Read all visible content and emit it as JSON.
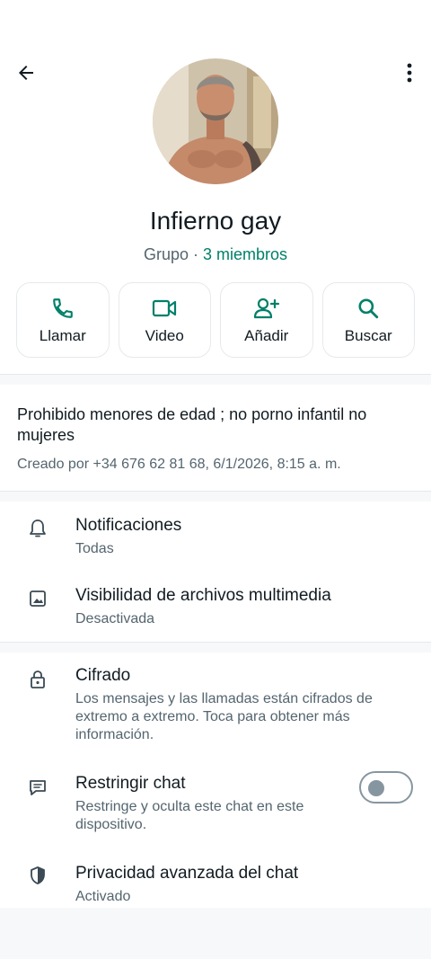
{
  "header": {
    "back_icon": "arrow-left-icon",
    "menu_icon": "more-vertical-icon"
  },
  "group": {
    "name": "Infierno gay",
    "type_label": "Grupo",
    "separator": " · ",
    "members_label": "3 miembros"
  },
  "actions": [
    {
      "label": "Llamar",
      "icon": "phone-icon"
    },
    {
      "label": "Video",
      "icon": "video-icon"
    },
    {
      "label": "Añadir",
      "icon": "add-person-icon"
    },
    {
      "label": "Buscar",
      "icon": "search-icon"
    }
  ],
  "description": {
    "text": "Prohibido menores de edad ; no porno infantil no mujeres",
    "created": "Creado por +34 676 62 81 68, 6/1/2026, 8:15 a. m."
  },
  "settings": {
    "notifications": {
      "title": "Notificaciones",
      "subtitle": "Todas"
    },
    "media": {
      "title": "Visibilidad de archivos multimedia",
      "subtitle": "Desactivada"
    },
    "encryption": {
      "title": "Cifrado",
      "subtitle": "Los mensajes y las llamadas están cifrados de extremo a extremo. Toca para obtener más información."
    },
    "restrict": {
      "title": "Restringir chat",
      "subtitle": "Restringe y oculta este chat en este dispositivo.",
      "enabled": false
    },
    "privacy": {
      "title": "Privacidad avanzada del chat",
      "subtitle": "Activado"
    }
  },
  "colors": {
    "accent": "#008069",
    "text_primary": "#111b21",
    "text_secondary": "#54656f"
  }
}
